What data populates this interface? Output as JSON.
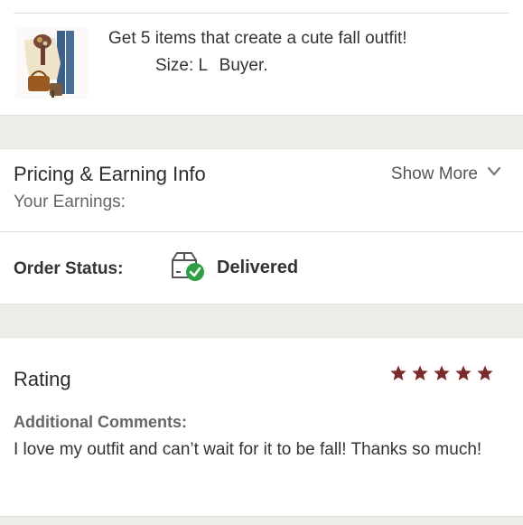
{
  "order_item": {
    "title": "Get 5 items that create a cute fall outfit!",
    "size": "Size: L",
    "buyer": "Buyer."
  },
  "pricing": {
    "title": "Pricing & Earning Info",
    "show_more": "Show More",
    "earnings_label": "Your Earnings:"
  },
  "order_status": {
    "label": "Order Status:",
    "value": "Delivered",
    "icon": "package-delivered-icon"
  },
  "rating": {
    "title": "Rating",
    "stars": 5,
    "max_stars": 5,
    "comments_label": "Additional Comments:",
    "comments": "I love my outfit and can’t wait for it to be fall! Thanks so much!"
  },
  "colors": {
    "star": "#7a2c2c",
    "check": "#2ea043",
    "band": "#efedea",
    "divider": "#dcdcdc"
  }
}
